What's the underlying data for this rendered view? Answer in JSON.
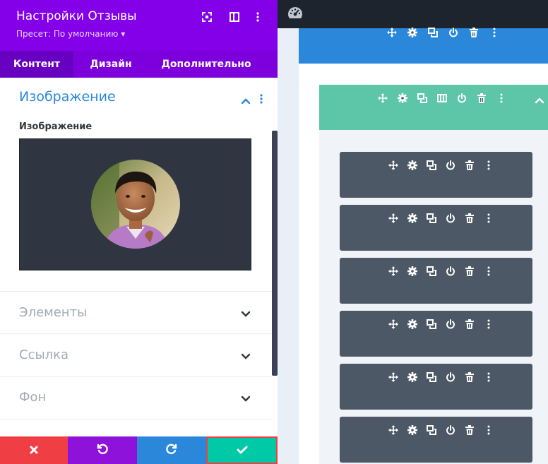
{
  "panel": {
    "title": "Настройки Отзывы",
    "preset": "Пресет: По умолчанию ▾",
    "tabs": [
      {
        "label": "Контент",
        "active": true
      },
      {
        "label": "Дизайн",
        "active": false
      },
      {
        "label": "Дополнительно",
        "active": false
      }
    ],
    "open_section": {
      "title": "Изображение",
      "field_label": "Изображение"
    },
    "sections": [
      {
        "title": "Элементы"
      },
      {
        "title": "Ссылка"
      },
      {
        "title": "Фон"
      }
    ]
  },
  "colors": {
    "header_purple": "#8300e9",
    "tab_purple": "#7d00dc",
    "accent_blue": "#2b87da",
    "cancel_red": "#ef3f45",
    "undo_purple": "#8f12da",
    "redo_blue": "#2b87da",
    "save_green": "#00c9a7",
    "module_gray": "#4c5866",
    "row_green": "#5dc6a9"
  },
  "footer": {
    "buttons": [
      "close-icon",
      "undo-icon",
      "redo-icon",
      "checkmark-icon"
    ]
  },
  "canvas": {
    "topbar_icon": "speedometer-icon",
    "module_count": 6,
    "module_toolbar_icons": [
      "move-icon",
      "gear-icon",
      "duplicate-icon",
      "power-icon",
      "trash-icon",
      "more-icon"
    ],
    "row_toolbar_icons": [
      "move-icon",
      "gear-icon",
      "duplicate-icon",
      "columns-icon",
      "power-icon",
      "trash-icon",
      "more-icon"
    ]
  }
}
